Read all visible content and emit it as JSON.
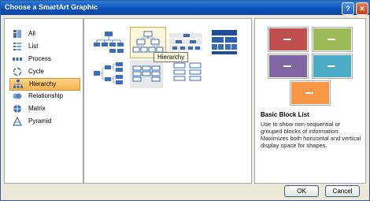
{
  "window": {
    "title": "Choose a SmartArt Graphic",
    "help_label": "?",
    "close_label": "✕"
  },
  "categories": [
    {
      "label": "All",
      "icon": "all-icon"
    },
    {
      "label": "List",
      "icon": "list-icon"
    },
    {
      "label": "Process",
      "icon": "process-icon"
    },
    {
      "label": "Cycle",
      "icon": "cycle-icon"
    },
    {
      "label": "Hierarchy",
      "icon": "hierarchy-icon",
      "selected": true
    },
    {
      "label": "Relationship",
      "icon": "relationship-icon"
    },
    {
      "label": "Matrix",
      "icon": "matrix-icon"
    },
    {
      "label": "Pyramid",
      "icon": "pyramid-icon"
    }
  ],
  "tooltip": "Hierarchy",
  "preview": {
    "title": "Basic Block List",
    "description": "Use to show non-sequential or grouped blocks of information. Maximizes both horizontal and vertical display space for shapes.",
    "block_colors": [
      "#c0504d",
      "#9bbb59",
      "#8064a2",
      "#4bacc6",
      "#f79646"
    ]
  },
  "buttons": {
    "ok": "OK",
    "cancel": "Cancel"
  }
}
